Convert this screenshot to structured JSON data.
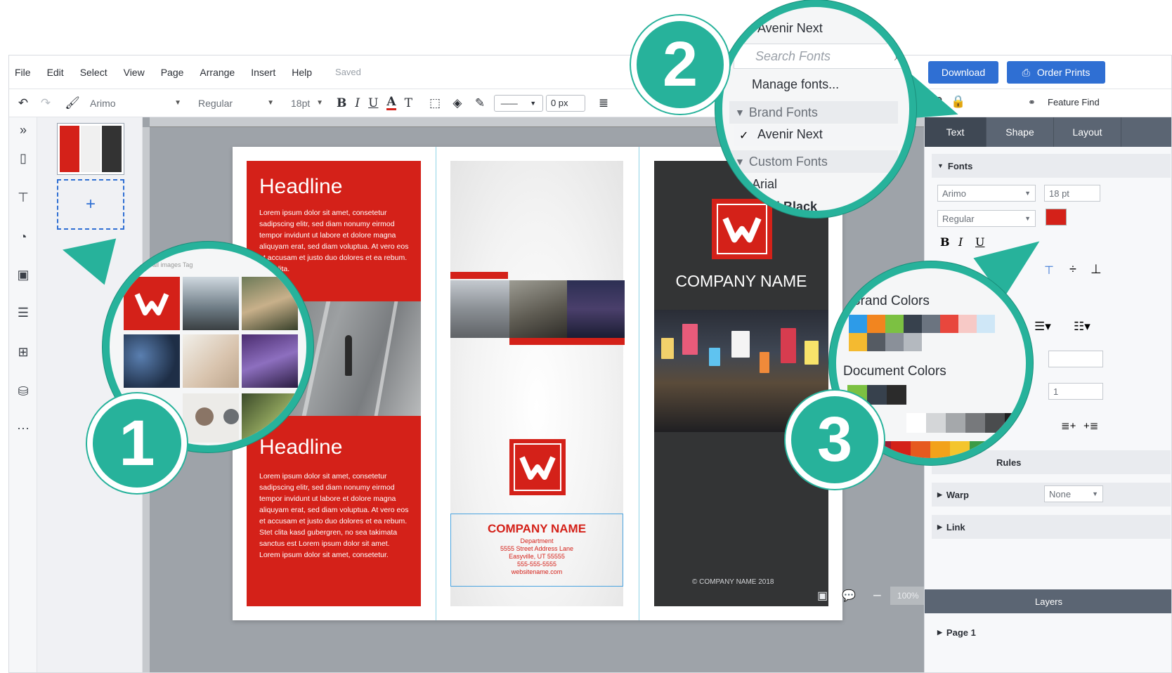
{
  "menubar": {
    "items": [
      "File",
      "Edit",
      "Select",
      "View",
      "Page",
      "Arrange",
      "Insert",
      "Help"
    ],
    "status": "Saved",
    "download_label": "Download",
    "order_prints_label": "Order Prints"
  },
  "toolbar": {
    "font": "Arimo",
    "weight": "Regular",
    "size": "18pt",
    "bold": "B",
    "italic": "I",
    "underline": "U",
    "text_color": "A",
    "text_size": "T",
    "line_width": "0 px"
  },
  "right_panel": {
    "feature_find": "Feature Find",
    "tabs": [
      "Text",
      "Shape",
      "Layout"
    ],
    "fonts_section": "Fonts",
    "font": "Arimo",
    "size": "18 pt",
    "weight": "Regular",
    "fmt_bold": "B",
    "fmt_italic": "I",
    "fmt_underline": "U",
    "spacing_value": "1",
    "rules_label": "Rules",
    "warp_label": "Warp",
    "warp_value": "None",
    "link_label": "Link",
    "layers_label": "Layers",
    "page_label": "Page 1",
    "accent_color": "#d42119"
  },
  "brochure": {
    "headline_1": "Headline",
    "body_1": "Lorem ipsum dolor sit amet, consetetur sadipscing elitr, sed diam nonumy eirmod tempor invidunt ut labore et dolore magna aliquyam erat, sed diam voluptua. At vero eos et accusam et justo duo dolores et ea rebum. Stet clita.",
    "headline_2": "Headline",
    "body_2": "Lorem ipsum dolor sit amet, consetetur sadipscing elitr, sed diam nonumy eirmod tempor invidunt ut labore et dolore magna aliquyam erat, sed diam voluptua. At vero eos et accusam et justo duo dolores et ea rebum. Stet clita kasd gubergren, no sea takimata sanctus est Lorem ipsum dolor sit amet. Lorem ipsum dolor sit amet, consetetur.",
    "company_name_center": "COMPANY NAME",
    "department": "Department",
    "address": "5555 Street Address Lane",
    "city": "Easyville, UT 55555",
    "phone": "555-555-5555",
    "website": "websitename.com",
    "company_name_right": "COMPANY NAME",
    "copyright": "© COMPANY NAME 2018",
    "brand_red": "#d42119"
  },
  "zoom": {
    "value": "100%",
    "minus": "−",
    "plus": "+"
  },
  "callout_1": {
    "number": "1",
    "header": "Search all images Tag"
  },
  "callout_2": {
    "number": "2",
    "current_font": "Avenir Next",
    "search_placeholder": "Search Fonts",
    "manage_fonts": "Manage fonts...",
    "brand_fonts_header": "Brand Fonts",
    "brand_font_selected": "Avenir Next",
    "custom_fonts_header": "Custom Fonts",
    "custom_font_1": "Arial",
    "custom_font_2": "Arial Black"
  },
  "callout_3": {
    "number": "3",
    "brand_colors_header": "Brand Colors",
    "document_colors_header": "Document Colors",
    "brand_colors": [
      "#2d9be8",
      "#f2851f",
      "#7cc142",
      "#37414d",
      "#6b7480",
      "#e8473d",
      "#f7c9c6",
      "#cfe7f7",
      "#f4ba30",
      "#555b63",
      "#8a9099",
      "#b4b9bf"
    ],
    "document_colors": [
      "#7cc142",
      "#37414d",
      "#2b2b2b"
    ],
    "grays": [
      "#ffffff",
      "#d4d6d8",
      "#a5a8ab",
      "#77797c",
      "#4a4c4e",
      "#1e1f20"
    ],
    "rainbow": [
      "#9e1b32",
      "#d42119",
      "#e65a1f",
      "#f2a21a",
      "#f4c52d",
      "#3b9b46",
      "#1d6f5a",
      "#1f7fb8",
      "#2458a6"
    ]
  },
  "theme": {
    "teal": "#27b29b",
    "blue": "#2f6fd3"
  }
}
